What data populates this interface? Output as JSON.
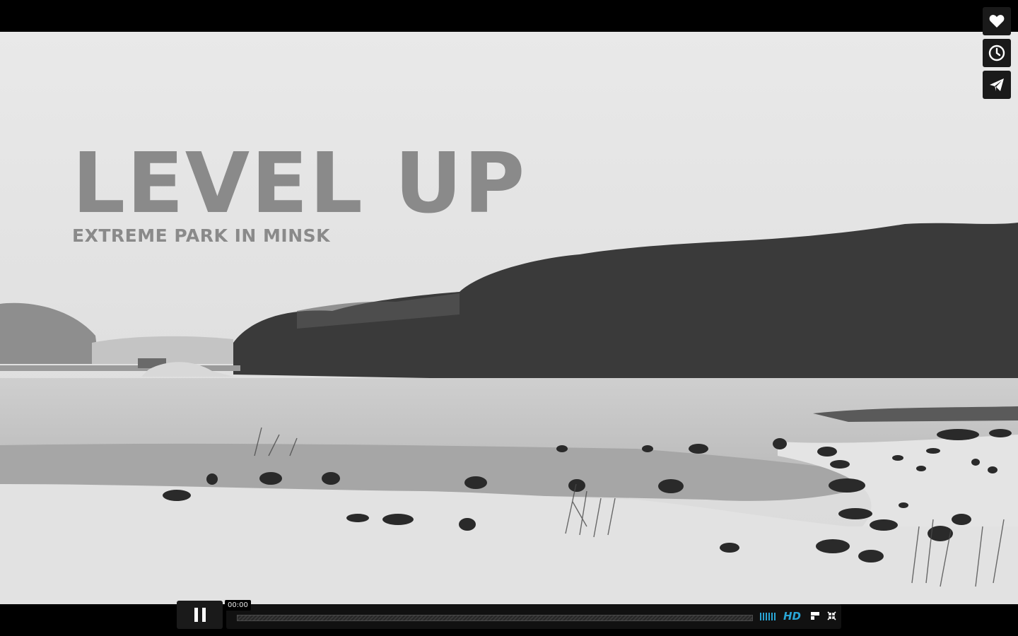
{
  "video": {
    "title": "LEVEL UP",
    "subtitle": "EXTREME PARK IN MINSK"
  },
  "side_actions": [
    {
      "name": "like",
      "icon": "heart-icon"
    },
    {
      "name": "watch-later",
      "icon": "clock-icon"
    },
    {
      "name": "share",
      "icon": "paper-plane-icon"
    }
  ],
  "player": {
    "state": "playing",
    "current_time": "00:00",
    "progress": 0,
    "quality_label": "HD",
    "accent_color": "#2aa6d6",
    "icons": [
      "pause-icon",
      "volume-icon",
      "popout-icon",
      "fullscreen-exit-icon"
    ]
  }
}
